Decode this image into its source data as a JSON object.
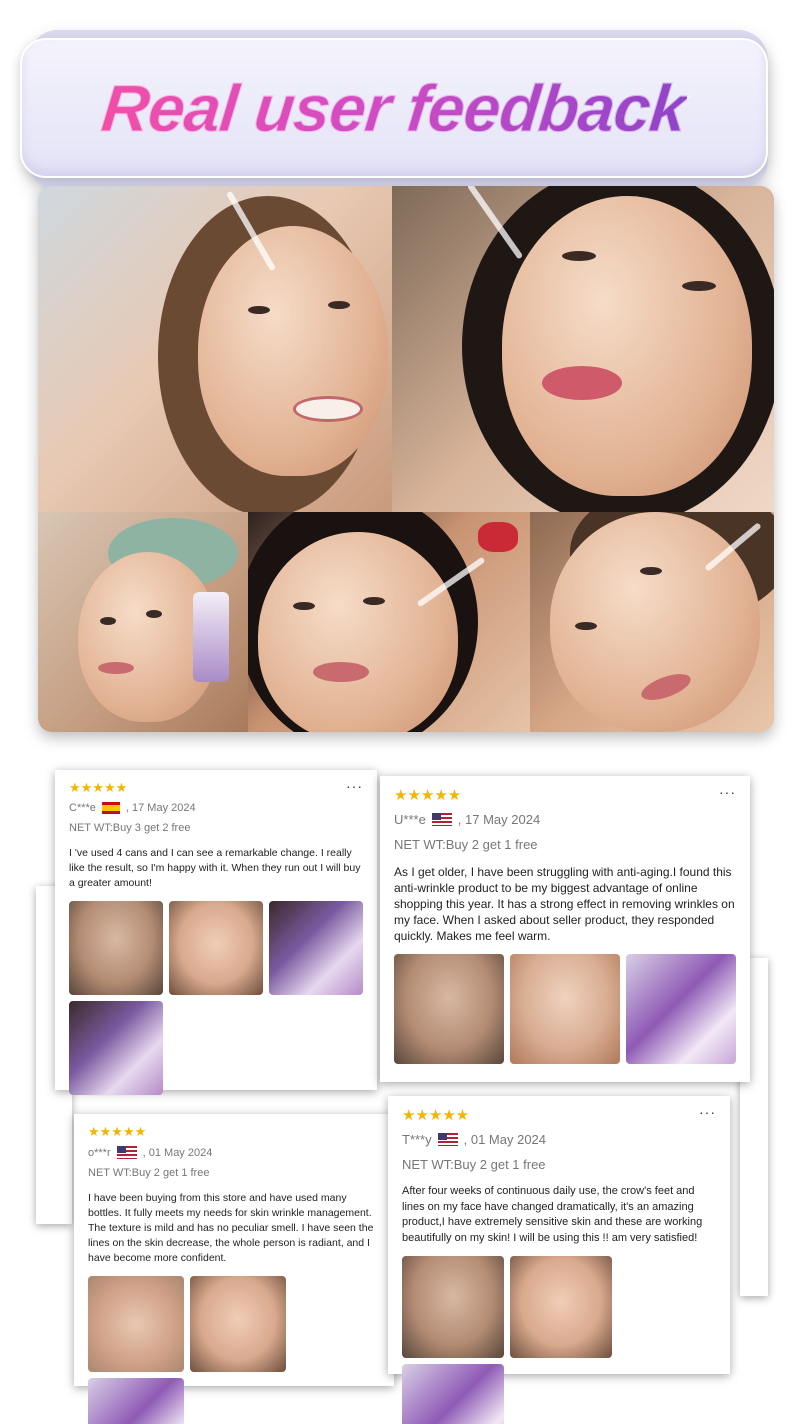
{
  "banner": {
    "title": "Real user feedback"
  },
  "icons": {
    "star": "star-icon",
    "more": "more-options-icon",
    "flag_es": "spain-flag-icon",
    "flag_us": "usa-flag-icon"
  },
  "colors": {
    "star": "#f5b400",
    "title_gradient_start": "#f04fa8",
    "title_gradient_end": "#8f44c9"
  },
  "reviews": [
    {
      "rating": "★★★★★",
      "more": "···",
      "user": "C***e",
      "date": ", 17 May 2024",
      "net_wt": "NET WT:Buy 3 get 2 free",
      "text": "I 've used 4 cans and I can see a remarkable change. I really like the result, so I'm happy with it. When they run out I will buy a greater amount!"
    },
    {
      "rating": "★★★★★",
      "more": "···",
      "user": "U***e",
      "date": ", 17 May 2024",
      "net_wt": "NET WT:Buy 2 get 1 free",
      "text": "As I get older, I have been struggling with anti-aging.I found this anti-wrinkle product to be my biggest advantage of online shopping this year. It has a strong effect in removing wrinkles on my face. When I asked about seller product, they responded quickly. Makes me feel warm."
    },
    {
      "rating": "★★★★★",
      "more": "···",
      "user": "o***r",
      "date": ", 01 May 2024",
      "net_wt": "NET WT:Buy 2 get 1 free",
      "text": "I have been buying from this store and have used many bottles. It fully meets my needs for skin wrinkle management. The texture is mild and has no peculiar smell. I have seen the lines on the skin decrease, the whole person is radiant, and I have become more confident."
    },
    {
      "rating": "★★★★★",
      "more": "···",
      "user": "T***y",
      "date": ", 01 May 2024",
      "net_wt": "NET WT:Buy 2 get 1 free",
      "text": "After four weeks of continuous daily use, the crow's feet and lines on my face have changed dramatically, it's an amazing product,I have extremely sensitive skin and these are working beautifully on my skin! I will be using this !! am very satisfied!"
    }
  ]
}
